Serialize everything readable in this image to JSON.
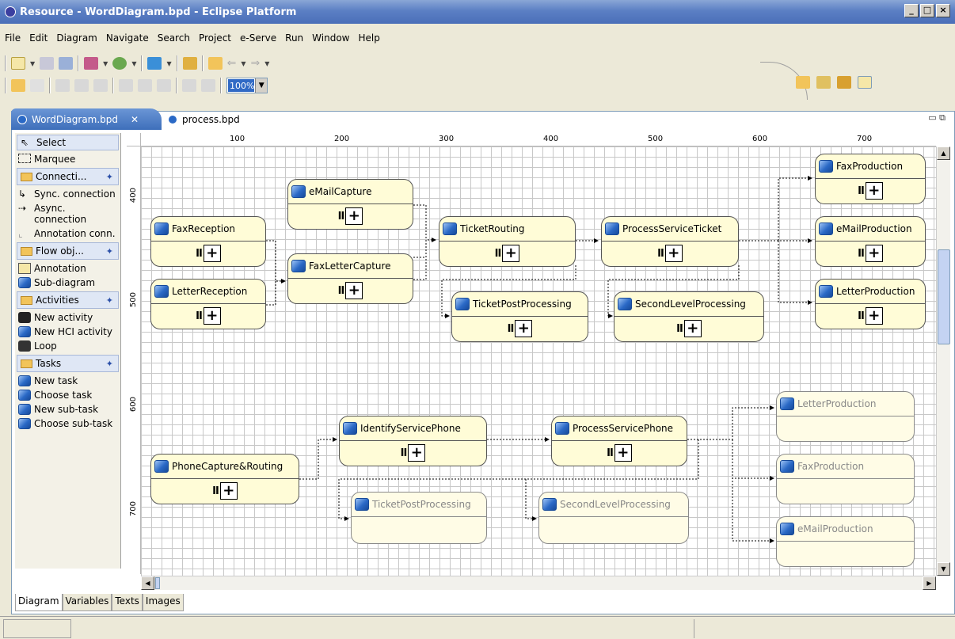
{
  "window": {
    "title": "Resource - WordDiagram.bpd - Eclipse Platform",
    "controls": [
      "_",
      "□",
      "×"
    ]
  },
  "menu": [
    "File",
    "Edit",
    "Diagram",
    "Navigate",
    "Search",
    "Project",
    "e-Serve",
    "Run",
    "Window",
    "Help"
  ],
  "toolbar": {
    "zoom": "100%"
  },
  "tabs": [
    {
      "label": "WordDiagram.bpd",
      "active": true
    },
    {
      "label": "process.bpd",
      "active": false
    }
  ],
  "palette": {
    "select": "Select",
    "marquee": "Marquee",
    "drawers": [
      {
        "label": "Connecti...",
        "items": [
          "Sync. connection",
          "Async. connection",
          "Annotation conn."
        ]
      },
      {
        "label": "Flow obj...",
        "items": [
          "Annotation",
          "Sub-diagram"
        ]
      },
      {
        "label": "Activities",
        "items": [
          "New activity",
          "New HCI activity",
          "Loop"
        ]
      },
      {
        "label": "Tasks",
        "items": [
          "New task",
          "Choose task",
          "New sub-task",
          "Choose sub-task"
        ]
      }
    ]
  },
  "ruler": {
    "h": [
      "100",
      "200",
      "300",
      "400",
      "500",
      "600",
      "700"
    ],
    "v": [
      "400",
      "500",
      "600",
      "700"
    ]
  },
  "nodes": {
    "fax_reception": "FaxReception",
    "letter_reception": "LetterReception",
    "email_capture": "eMailCapture",
    "fax_letter_capture": "FaxLetterCapture",
    "ticket_routing": "TicketRouting",
    "process_service_ticket": "ProcessServiceTicket",
    "ticket_post_processing": "TicketPostProcessing",
    "second_level_processing": "SecondLevelProcessing",
    "fax_production": "FaxProduction",
    "email_production": "eMailProduction",
    "letter_production": "LetterProduction",
    "phone_capture_routing": "PhoneCapture&Routing",
    "identify_service_phone": "IdentifyServicePhone",
    "process_service_phone": "ProcessServicePhone",
    "ghost_ticket_post_processing": "TicketPostProcessing",
    "ghost_second_level_processing": "SecondLevelProcessing",
    "ghost_letter_production": "LetterProduction",
    "ghost_fax_production": "FaxProduction",
    "ghost_email_production": "eMailProduction"
  },
  "body_glyphs": {
    "pause": "II",
    "plus": "+"
  },
  "bottom_tabs": [
    "Diagram",
    "Variables",
    "Texts",
    "Images"
  ],
  "colors": {
    "node_fill": "#fffcd7",
    "title_bar": "#5b7fc4",
    "task_icon": "#2a69c6"
  }
}
